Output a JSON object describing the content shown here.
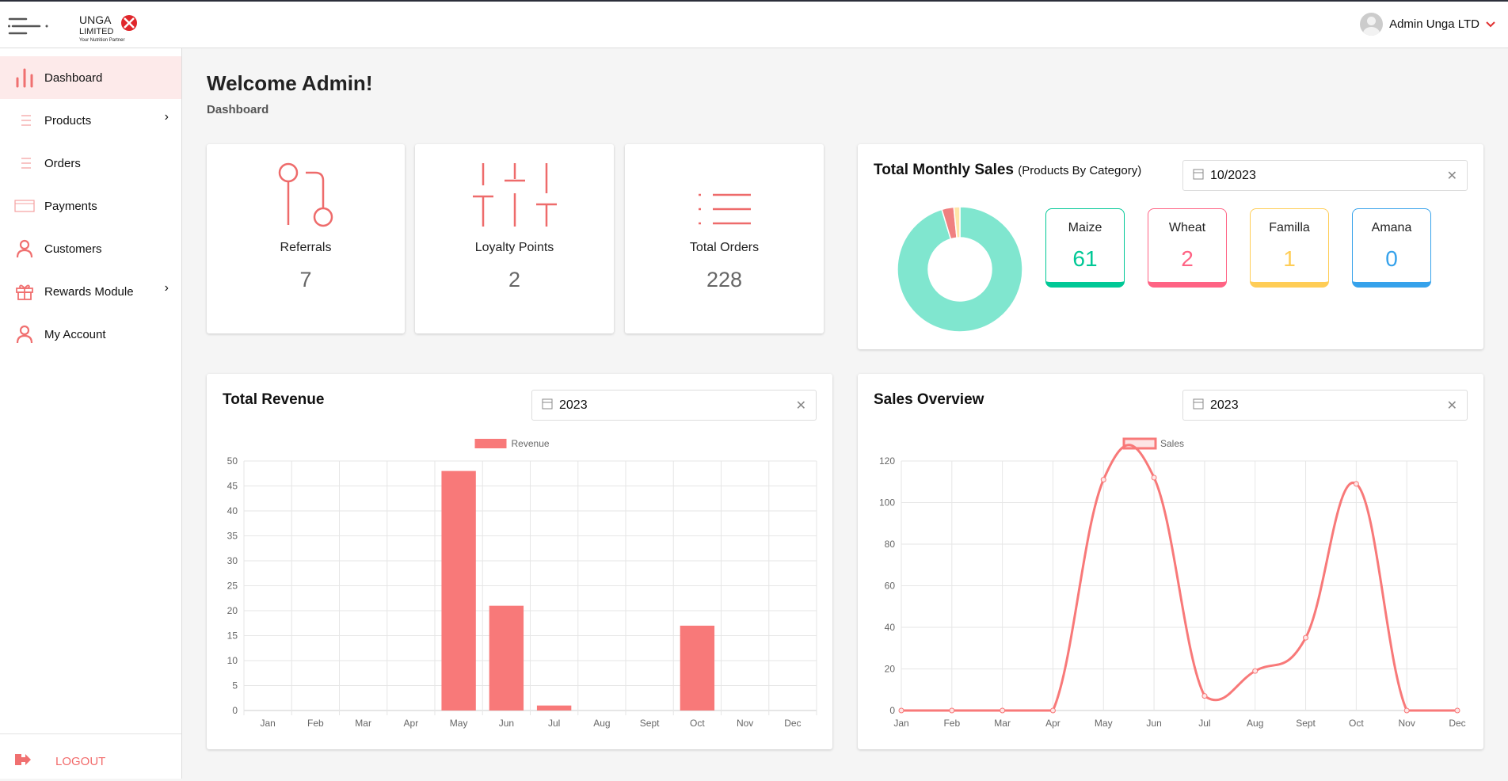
{
  "header": {
    "logo": {
      "line1": "UNGA",
      "line2": "LIMITED",
      "tagline": "Your Nutrition Partner"
    },
    "user_name": "Admin Unga LTD",
    "menu_icon": "hamburger-icon"
  },
  "sidebar": {
    "items": [
      {
        "label": "Dashboard",
        "icon": "bar-chart-icon",
        "active": true
      },
      {
        "label": "Products",
        "icon": "list-icon",
        "submenu": true
      },
      {
        "label": "Orders",
        "icon": "list-icon"
      },
      {
        "label": "Payments",
        "icon": "credit-card-icon"
      },
      {
        "label": "Customers",
        "icon": "user-icon"
      },
      {
        "label": "Rewards Module",
        "icon": "gift-icon",
        "submenu": true
      },
      {
        "label": "My Account",
        "icon": "user-icon"
      }
    ],
    "logout": "LOGOUT"
  },
  "page": {
    "title": "Welcome Admin!",
    "breadcrumb": "Dashboard"
  },
  "stats": [
    {
      "label": "Referrals",
      "value": "7"
    },
    {
      "label": "Loyalty Points",
      "value": "2"
    },
    {
      "label": "Total Orders",
      "value": "228"
    }
  ],
  "monthly_sales": {
    "title": "Total Monthly Sales",
    "subtitle": "(Products By Category)",
    "date": "10/2023",
    "categories": [
      {
        "name": "Maize",
        "value": "61",
        "color": "#00c896"
      },
      {
        "name": "Wheat",
        "value": "2",
        "color": "#ff6384"
      },
      {
        "name": "Famillа",
        "value": "1",
        "color": "#ffcd56"
      },
      {
        "name": "Amana",
        "value": "0",
        "color": "#36a2eb"
      }
    ]
  },
  "revenue": {
    "title": "Total Revenue",
    "date": "2023"
  },
  "sales_overview": {
    "title": "Sales Overview",
    "date": "2023"
  },
  "chart_data": [
    {
      "type": "pie",
      "donut": true,
      "categories": [
        "Maize",
        "Wheat",
        "Famillа",
        "Amana"
      ],
      "values": [
        61,
        2,
        1,
        0
      ],
      "colors": [
        "#80e6cf",
        "#f08080",
        "#ffe5a8",
        "#9ad0f5"
      ]
    },
    {
      "type": "bar",
      "categories": [
        "Jan",
        "Feb",
        "Mar",
        "Apr",
        "May",
        "Jun",
        "Jul",
        "Aug",
        "Sept",
        "Oct",
        "Nov",
        "Dec"
      ],
      "series": [
        {
          "name": "Revenue",
          "values": [
            0,
            0,
            0,
            0,
            48,
            21,
            1,
            0,
            0,
            17,
            0,
            0
          ]
        }
      ],
      "ylim": [
        0,
        50
      ],
      "yticks": [
        0,
        5,
        10,
        15,
        20,
        25,
        30,
        35,
        40,
        45,
        50
      ],
      "grid": true,
      "legend": "top",
      "color": "#f87979"
    },
    {
      "type": "line",
      "categories": [
        "Jan",
        "Feb",
        "Mar",
        "Apr",
        "May",
        "Jun",
        "Jul",
        "Aug",
        "Sept",
        "Oct",
        "Nov",
        "Dec"
      ],
      "series": [
        {
          "name": "Sales",
          "values": [
            0,
            0,
            0,
            0,
            111,
            112,
            7,
            19,
            35,
            109,
            0,
            0
          ]
        }
      ],
      "ylim": [
        0,
        120
      ],
      "yticks": [
        0,
        20,
        40,
        60,
        80,
        100,
        120
      ],
      "grid": true,
      "legend": "top",
      "smooth": true,
      "color": "#f87979"
    }
  ]
}
